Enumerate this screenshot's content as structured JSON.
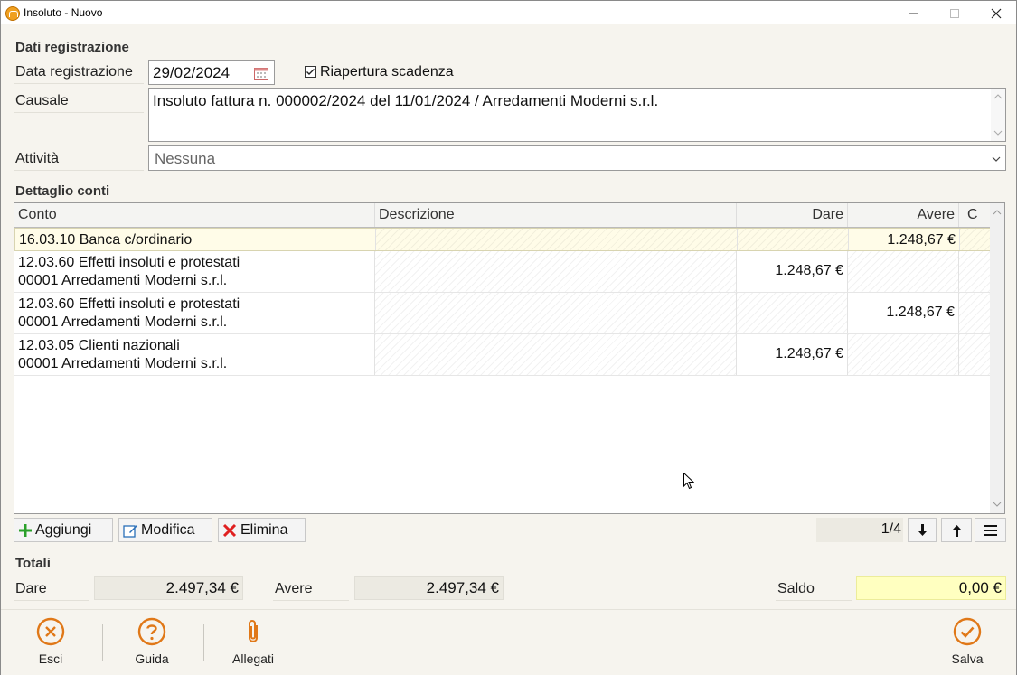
{
  "window": {
    "title": "Insoluto - Nuovo"
  },
  "registrazione": {
    "section_title": "Dati registrazione",
    "data_label": "Data registrazione",
    "data_value": "29/02/2024",
    "riapertura_label": "Riapertura scadenza",
    "riapertura_checked": true,
    "causale_label": "Causale",
    "causale_value": "Insoluto fattura n. 000002/2024 del 11/01/2024 / Arredamenti Moderni s.r.l.",
    "attivita_label": "Attività",
    "attivita_value": "Nessuna"
  },
  "dettaglio": {
    "section_title": "Dettaglio conti",
    "columns": {
      "conto": "Conto",
      "descrizione": "Descrizione",
      "dare": "Dare",
      "avere": "Avere",
      "c": "C"
    },
    "rows": [
      {
        "conto_line1": "16.03.10 Banca c/ordinario",
        "conto_line2": "",
        "descrizione": "",
        "dare": "",
        "avere": "1.248,67 €"
      },
      {
        "conto_line1": "12.03.60 Effetti insoluti e protestati",
        "conto_line2": "00001 Arredamenti Moderni s.r.l.",
        "descrizione": "",
        "dare": "1.248,67 €",
        "avere": ""
      },
      {
        "conto_line1": "12.03.60 Effetti insoluti e protestati",
        "conto_line2": "00001 Arredamenti Moderni s.r.l.",
        "descrizione": "",
        "dare": "",
        "avere": "1.248,67 €"
      },
      {
        "conto_line1": "12.03.05 Clienti nazionali",
        "conto_line2": "00001 Arredamenti Moderni s.r.l.",
        "descrizione": "",
        "dare": "1.248,67 €",
        "avere": ""
      }
    ],
    "toolbar": {
      "aggiungi": "Aggiungi",
      "modifica": "Modifica",
      "elimina": "Elimina",
      "page": "1/4"
    }
  },
  "totali": {
    "section_title": "Totali",
    "dare_label": "Dare",
    "dare_value": "2.497,34 €",
    "avere_label": "Avere",
    "avere_value": "2.497,34 €",
    "saldo_label": "Saldo",
    "saldo_value": "0,00 €"
  },
  "footer": {
    "esci": "Esci",
    "guida": "Guida",
    "allegati": "Allegati",
    "salva": "Salva"
  },
  "colors": {
    "accent": "#e07818",
    "selected_row": "#fffce8",
    "saldo_bg": "#ffffc0"
  }
}
